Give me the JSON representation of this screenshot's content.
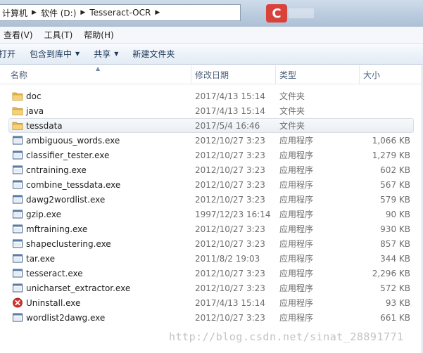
{
  "address_bar": {
    "crumbs": [
      "计算机",
      "软件 (D:)",
      "Tesseract-OCR"
    ]
  },
  "menu": [
    "查看(V)",
    "工具(T)",
    "帮助(H)"
  ],
  "commands": {
    "open": "打开",
    "include_library": "包含到库中",
    "share": "共享",
    "new_folder": "新建文件夹"
  },
  "columns": {
    "name": "名称",
    "date": "修改日期",
    "type": "类型",
    "size": "大小"
  },
  "files": [
    {
      "name": "doc",
      "date": "2017/4/13 15:14",
      "type": "文件夹",
      "size": "",
      "icon": "folder-icon"
    },
    {
      "name": "java",
      "date": "2017/4/13 15:14",
      "type": "文件夹",
      "size": "",
      "icon": "folder-icon"
    },
    {
      "name": "tessdata",
      "date": "2017/5/4 16:46",
      "type": "文件夹",
      "size": "",
      "icon": "folder-icon",
      "selected": true
    },
    {
      "name": "ambiguous_words.exe",
      "date": "2012/10/27 3:23",
      "type": "应用程序",
      "size": "1,066 KB",
      "icon": "app-icon"
    },
    {
      "name": "classifier_tester.exe",
      "date": "2012/10/27 3:23",
      "type": "应用程序",
      "size": "1,279 KB",
      "icon": "app-icon"
    },
    {
      "name": "cntraining.exe",
      "date": "2012/10/27 3:23",
      "type": "应用程序",
      "size": "602 KB",
      "icon": "app-icon"
    },
    {
      "name": "combine_tessdata.exe",
      "date": "2012/10/27 3:23",
      "type": "应用程序",
      "size": "567 KB",
      "icon": "app-icon"
    },
    {
      "name": "dawg2wordlist.exe",
      "date": "2012/10/27 3:23",
      "type": "应用程序",
      "size": "579 KB",
      "icon": "app-icon"
    },
    {
      "name": "gzip.exe",
      "date": "1997/12/23 16:14",
      "type": "应用程序",
      "size": "90 KB",
      "icon": "app-icon"
    },
    {
      "name": "mftraining.exe",
      "date": "2012/10/27 3:23",
      "type": "应用程序",
      "size": "930 KB",
      "icon": "app-icon"
    },
    {
      "name": "shapeclustering.exe",
      "date": "2012/10/27 3:23",
      "type": "应用程序",
      "size": "857 KB",
      "icon": "app-icon"
    },
    {
      "name": "tar.exe",
      "date": "2011/8/2 19:03",
      "type": "应用程序",
      "size": "344 KB",
      "icon": "app-icon"
    },
    {
      "name": "tesseract.exe",
      "date": "2012/10/27 3:23",
      "type": "应用程序",
      "size": "2,296 KB",
      "icon": "app-icon"
    },
    {
      "name": "unicharset_extractor.exe",
      "date": "2012/10/27 3:23",
      "type": "应用程序",
      "size": "572 KB",
      "icon": "app-icon"
    },
    {
      "name": "Uninstall.exe",
      "date": "2017/4/13 15:14",
      "type": "应用程序",
      "size": "93 KB",
      "icon": "uninstall-icon"
    },
    {
      "name": "wordlist2dawg.exe",
      "date": "2012/10/27 3:23",
      "type": "应用程序",
      "size": "661 KB",
      "icon": "app-icon"
    }
  ],
  "watermark": "http://blog.csdn.net/sinat_28891771",
  "colors": {
    "folder": "#e8b84a",
    "uninstall": "#d7312c",
    "accent_text": "#1e395b"
  }
}
